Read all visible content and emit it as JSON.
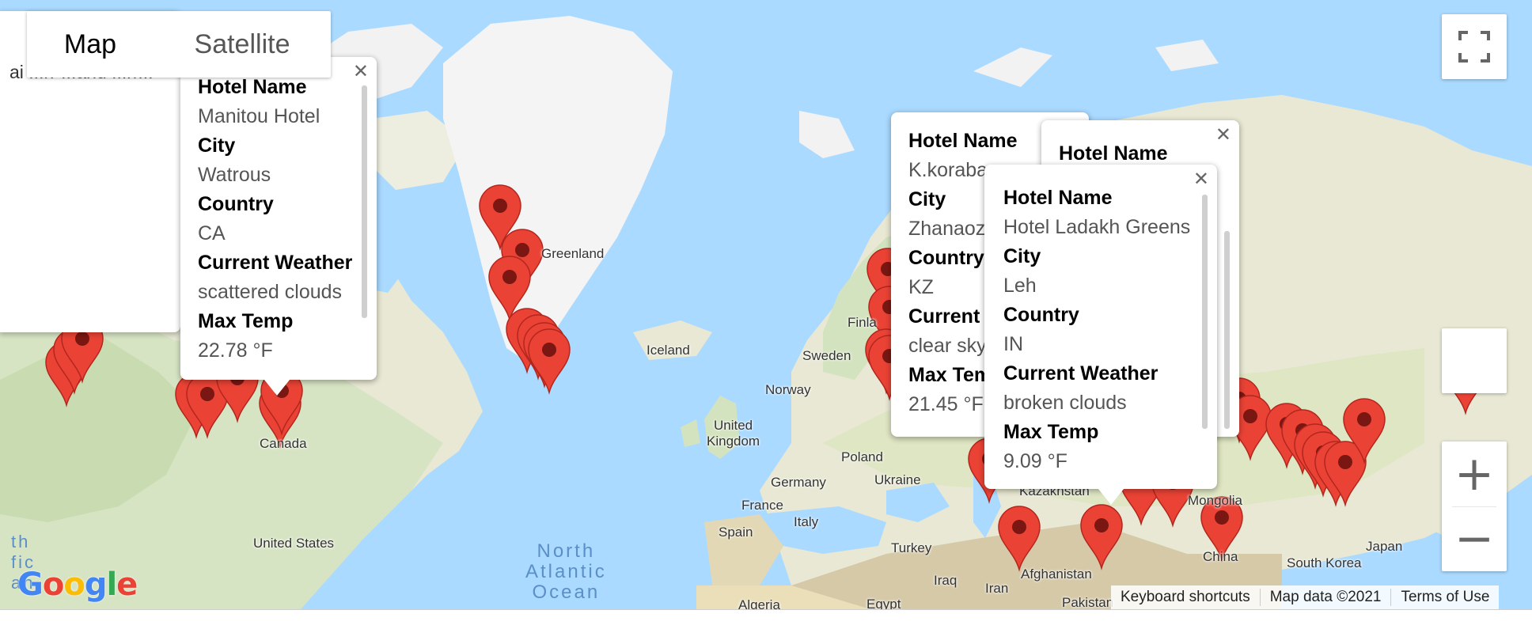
{
  "map_type": {
    "map_label": "Map",
    "satellite_label": "Satellite"
  },
  "labels": {
    "greenland": "Greenland",
    "iceland": "Iceland",
    "sweden": "Sweden",
    "finland": "Finla",
    "norway": "Norway",
    "united_kingdom": "United\nKingdom",
    "poland": "Poland",
    "germany": "Germany",
    "ukraine": "Ukraine",
    "france": "France",
    "spain": "Spain",
    "italy": "Italy",
    "turkey": "Turkey",
    "iraq": "Iraq",
    "iran": "Iran",
    "algeria": "Algeria",
    "egypt": "Egypt",
    "afghanistan": "Afghanistan",
    "pakistan": "Pakistan",
    "kazakhstan": "Kazakhstan",
    "mongolia": "Mongolia",
    "china": "China",
    "south_korea": "South Korea",
    "japan": "Japan",
    "canada": "Canada",
    "united_states": "United States",
    "ocean": "North\nAtlantic\nOcean",
    "left_edge_fragment": "th\nfic\nan"
  },
  "partial_window_text": "ai ...rr ...and ...rr...",
  "info_windows": [
    {
      "id": "watrous",
      "fields": [
        {
          "key": "Hotel Name",
          "value": "Manitou Hotel"
        },
        {
          "key": "City",
          "value": "Watrous"
        },
        {
          "key": "Country",
          "value": "CA"
        },
        {
          "key": "Current Weather",
          "value": "scattered clouds"
        },
        {
          "key": "Max Temp",
          "value": "22.78 °F"
        }
      ]
    },
    {
      "id": "zhanaozen",
      "fields": [
        {
          "key": "Hotel Name",
          "value": "K.koraba"
        },
        {
          "key": "City",
          "value": "Zhanaoz"
        },
        {
          "key": "Country",
          "value": "KZ"
        },
        {
          "key": "Current",
          "value": "clear sky"
        },
        {
          "key": "Max Tem",
          "value": "21.45 °F"
        }
      ]
    },
    {
      "id": "hidden",
      "fields": [
        {
          "key": "Hotel Name",
          "value": ""
        }
      ]
    },
    {
      "id": "leh",
      "fields": [
        {
          "key": "Hotel Name",
          "value": "Hotel Ladakh Greens"
        },
        {
          "key": "City",
          "value": "Leh"
        },
        {
          "key": "Country",
          "value": "IN"
        },
        {
          "key": "Current Weather",
          "value": "broken clouds"
        },
        {
          "key": "Max Temp",
          "value": "9.09 °F"
        }
      ]
    }
  ],
  "footer": {
    "keyboard_shortcuts": "Keyboard shortcuts",
    "map_data": "Map data ©2021",
    "terms": "Terms of Use"
  },
  "logo": "Google",
  "colors": {
    "water": "#aadaff",
    "land": "#e8e8d4",
    "marker": "#ea4335",
    "marker_dot": "#7a1712"
  }
}
